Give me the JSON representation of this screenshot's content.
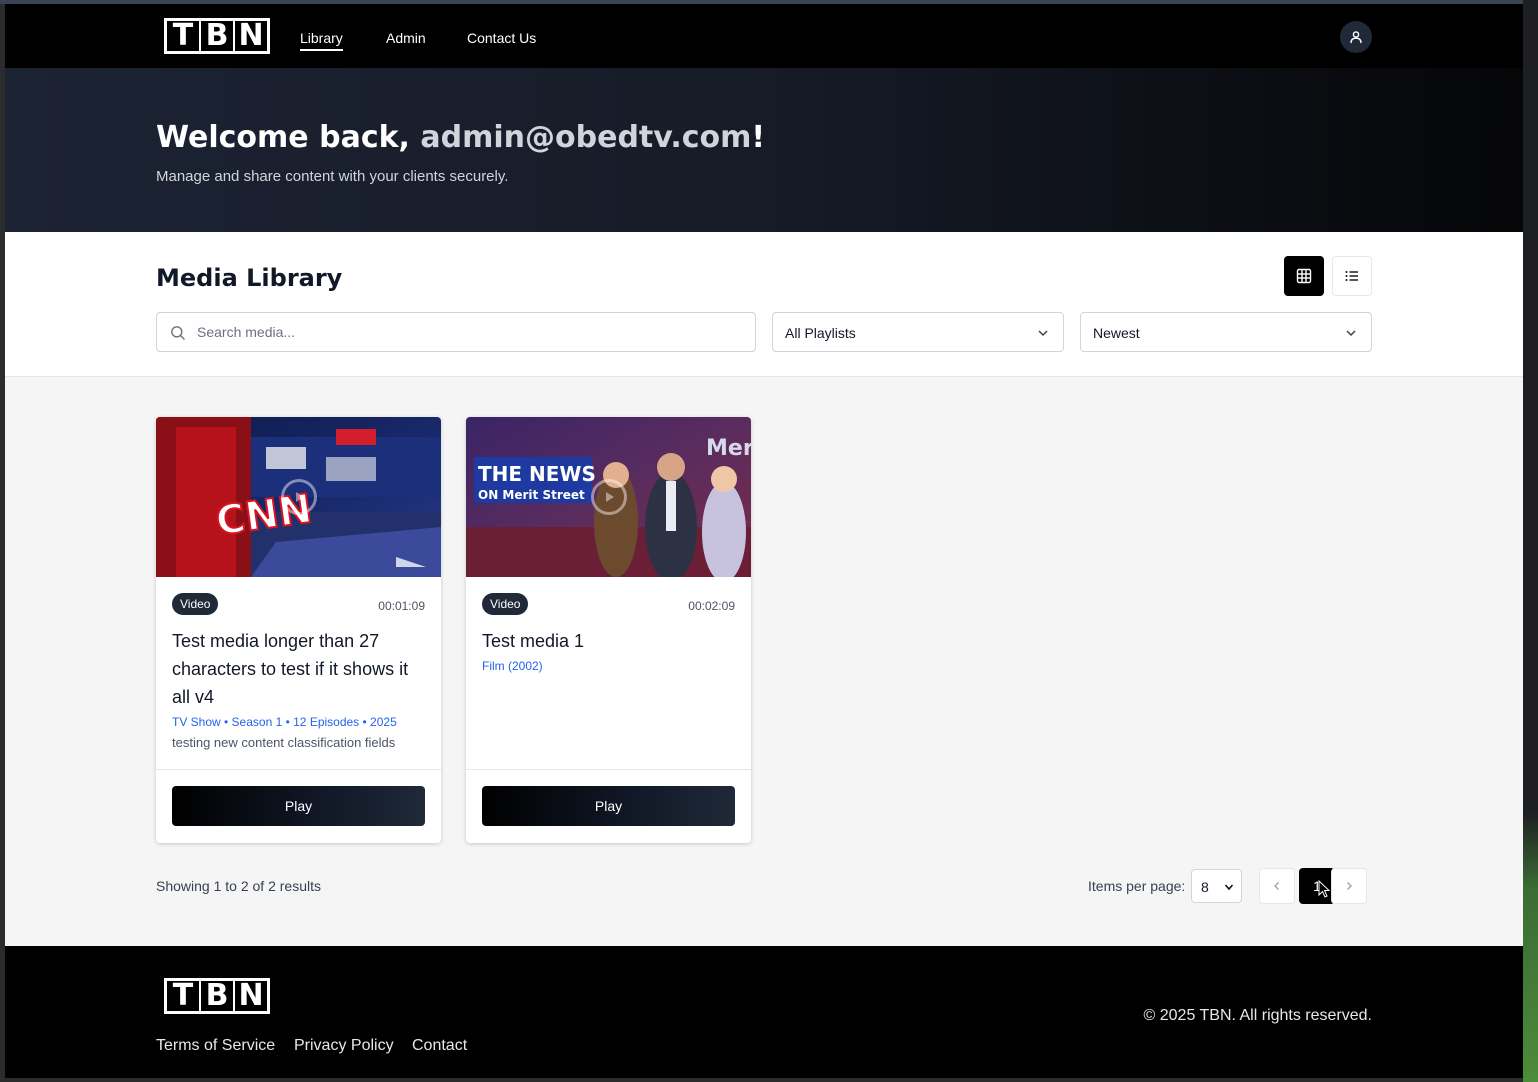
{
  "brand": {
    "logo_letters": [
      "T",
      "B",
      "N"
    ]
  },
  "nav": {
    "links": [
      "Library",
      "Admin",
      "Contact Us"
    ],
    "active": "Library",
    "account_icon": "user-icon"
  },
  "hero": {
    "title_prefix": "Welcome back, ",
    "email": "admin@obedtv.com",
    "title_suffix": "!",
    "subtitle": "Manage and share content with your clients securely."
  },
  "library": {
    "title": "Media Library",
    "view_modes": [
      "grid",
      "list"
    ],
    "active_view": "grid",
    "search": {
      "placeholder": "Search media...",
      "value": ""
    },
    "playlist_filter": "All Playlists",
    "sort": "Newest"
  },
  "media": [
    {
      "type": "Video",
      "duration": "00:01:09",
      "title": "Test media longer than 27 characters to test if it shows it all v4",
      "meta": "TV Show • Season 1 • 12 Episodes • 2025",
      "description": "testing new content classification fields",
      "play_label": "Play"
    },
    {
      "type": "Video",
      "duration": "00:02:09",
      "title": "Test media 1",
      "meta": "Film (2002)",
      "description": "",
      "play_label": "Play"
    }
  ],
  "thumb_text": {
    "cnn": "CNN",
    "news_line1": "THE NEWS",
    "news_line2": "ON Merit Street",
    "merit": "Merit"
  },
  "pagination": {
    "summary": "Showing 1 to 2 of 2 results",
    "items_per_page_label": "Items per page:",
    "items_per_page": "8",
    "current_page": "1"
  },
  "footer": {
    "links": [
      "Terms of Service",
      "Privacy Policy",
      "Contact"
    ],
    "copyright": "© 2025 TBN. All rights reserved."
  },
  "colors": {
    "accent": "#000000",
    "meta_link": "#2563eb",
    "badge_bg": "#1f2937"
  }
}
